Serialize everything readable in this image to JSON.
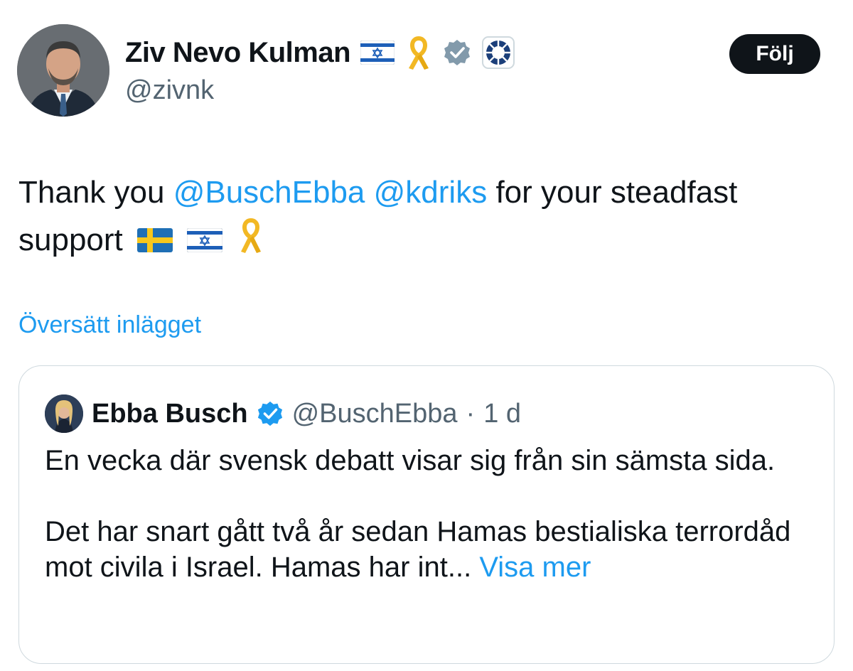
{
  "author": {
    "name": "Ziv Nevo Kulman",
    "handle": "@zivnk",
    "badges": [
      "israel-flag-icon",
      "yellow-ribbon-icon",
      "verified-gray-badge-icon",
      "organization-emblem-icon"
    ]
  },
  "follow_button": {
    "label": "Följ"
  },
  "tweet": {
    "text_before": "Thank you ",
    "mention_1": "@BuschEbba",
    "space": " ",
    "mention_2": "@kdriks",
    "text_after": " for your steadfast support",
    "emojis": [
      "sweden-flag-icon",
      "israel-flag-icon",
      "yellow-ribbon-icon"
    ]
  },
  "translate_link": "Översätt inlägget",
  "quote": {
    "name": "Ebba Busch",
    "handle": "@BuschEbba",
    "separator": "·",
    "time": "1 d",
    "paragraph_1": "En vecka där svensk debatt visar sig från sin sämsta sida.",
    "paragraph_2": "Det har snart gått två år sedan Hamas bestialiska terrordåd mot civila i Israel. Hamas har int...",
    "show_more": "Visa mer"
  },
  "colors": {
    "link": "#1d9bf0",
    "text": "#0f1419",
    "secondary": "#536471",
    "border": "#cfd9de",
    "button_bg": "#0f1419"
  }
}
